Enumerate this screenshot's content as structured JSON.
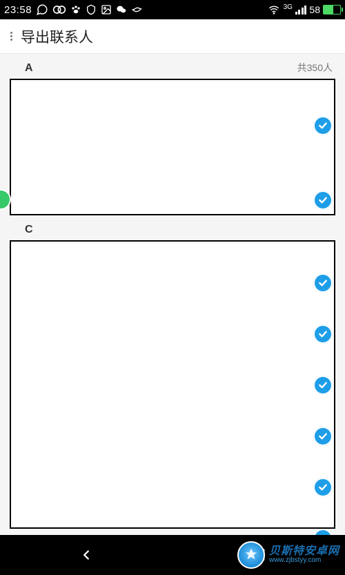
{
  "status": {
    "time": "23:58",
    "network_label": "3G",
    "battery_pct": "58"
  },
  "header": {
    "title": "导出联系人"
  },
  "sections": {
    "a": {
      "letter": "A",
      "count_label": "共350人"
    },
    "c": {
      "letter": "C"
    }
  },
  "watermark": {
    "name_cn": "贝斯特安卓网",
    "url": "www.zjbstyy.com"
  }
}
